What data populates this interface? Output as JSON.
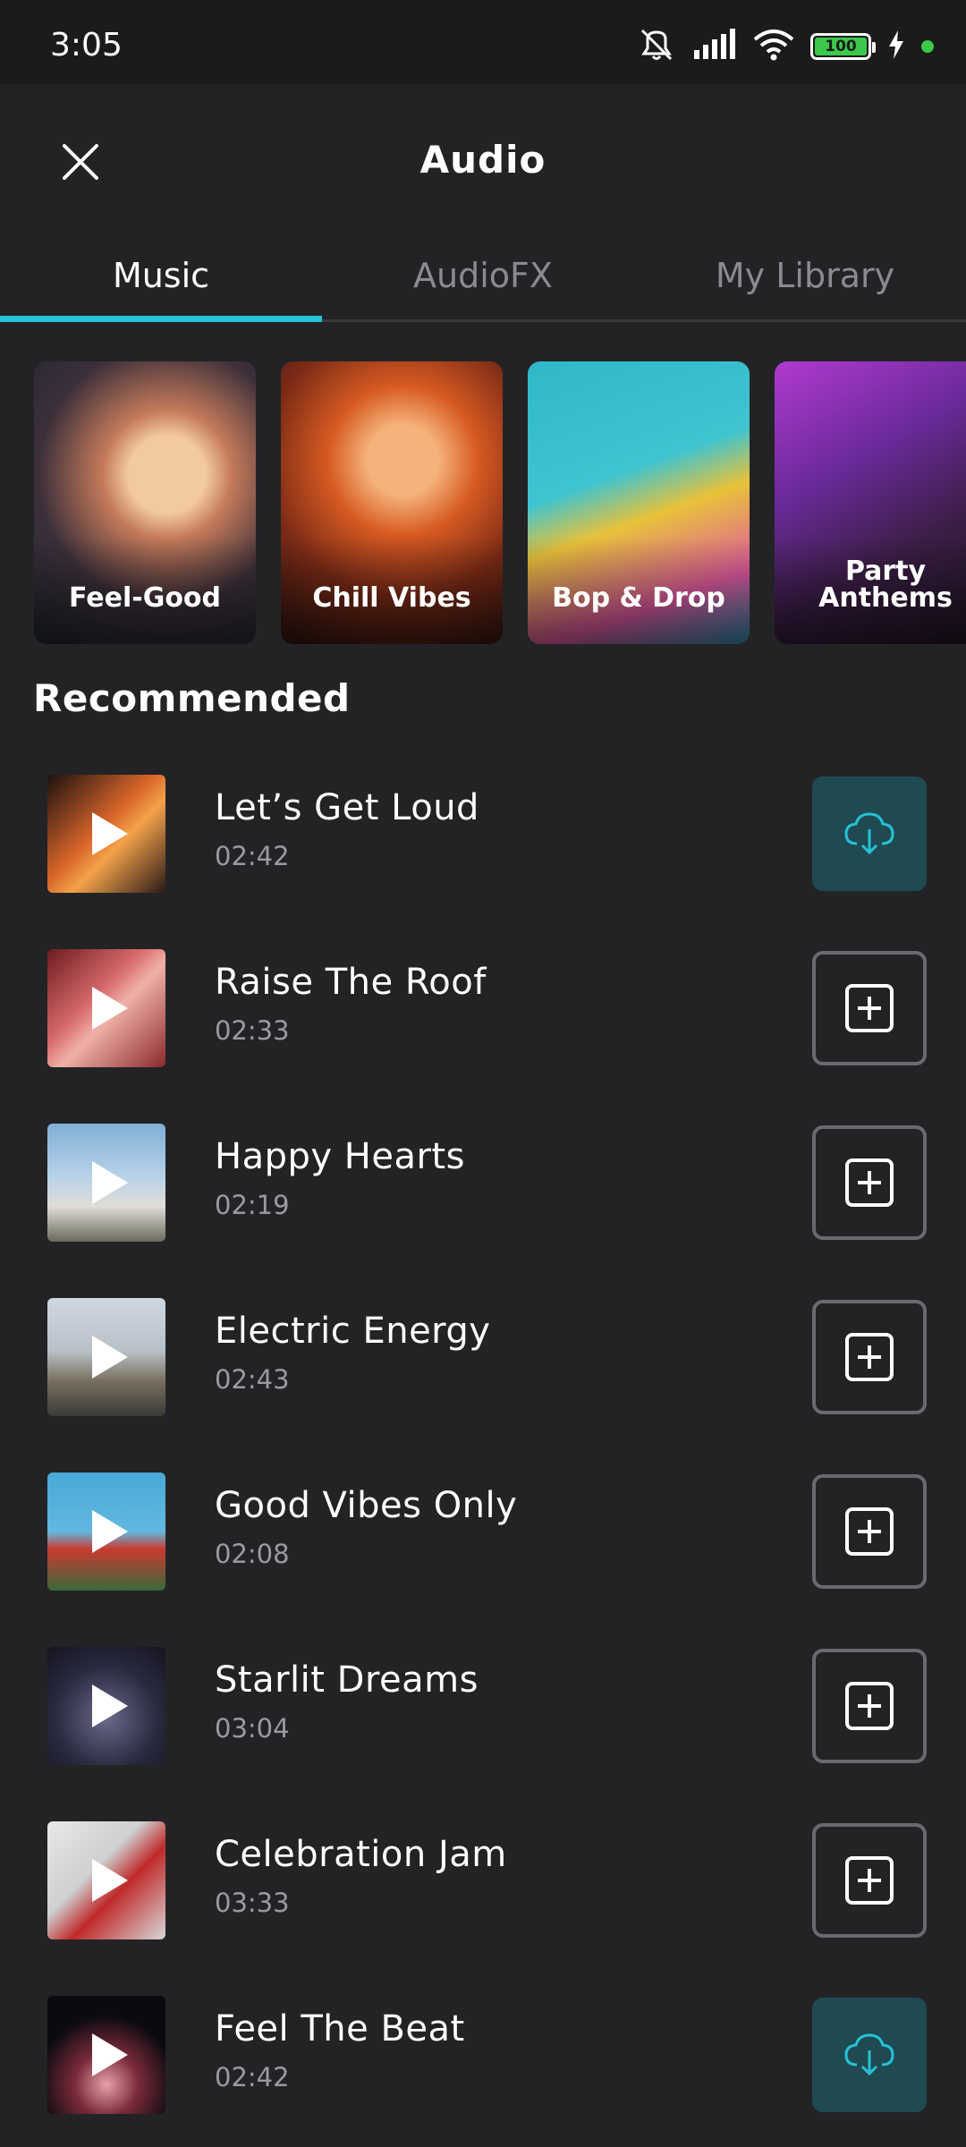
{
  "status_bar": {
    "time": "3:05",
    "battery": "100",
    "icons": [
      "mute-icon",
      "signal-icon",
      "wifi-icon",
      "battery-icon",
      "charging-icon"
    ]
  },
  "header": {
    "title": "Audio",
    "close_icon": "close-icon"
  },
  "tabs": [
    {
      "label": "Music",
      "active": true
    },
    {
      "label": "AudioFX",
      "active": false
    },
    {
      "label": "My Library",
      "active": false
    }
  ],
  "categories": [
    {
      "label": "Feel-Good"
    },
    {
      "label": "Chill Vibes"
    },
    {
      "label": "Bop & Drop"
    },
    {
      "label": "Party\nAnthems"
    }
  ],
  "section": {
    "title": "Recommended"
  },
  "tracks": [
    {
      "title": "Let’s Get Loud",
      "duration": "02:42",
      "action": "download"
    },
    {
      "title": "Raise The Roof",
      "duration": "02:33",
      "action": "add"
    },
    {
      "title": "Happy Hearts",
      "duration": "02:19",
      "action": "add"
    },
    {
      "title": "Electric Energy",
      "duration": "02:43",
      "action": "add"
    },
    {
      "title": "Good Vibes Only",
      "duration": "02:08",
      "action": "add"
    },
    {
      "title": "Starlit Dreams",
      "duration": "03:04",
      "action": "add"
    },
    {
      "title": "Celebration Jam",
      "duration": "03:33",
      "action": "add"
    },
    {
      "title": "Feel The Beat",
      "duration": "02:42",
      "action": "download"
    }
  ],
  "colors": {
    "background": "#232325",
    "accent": "#26c2d6",
    "download_bg": "#1f4a52",
    "muted_text": "#9a9aa0"
  }
}
